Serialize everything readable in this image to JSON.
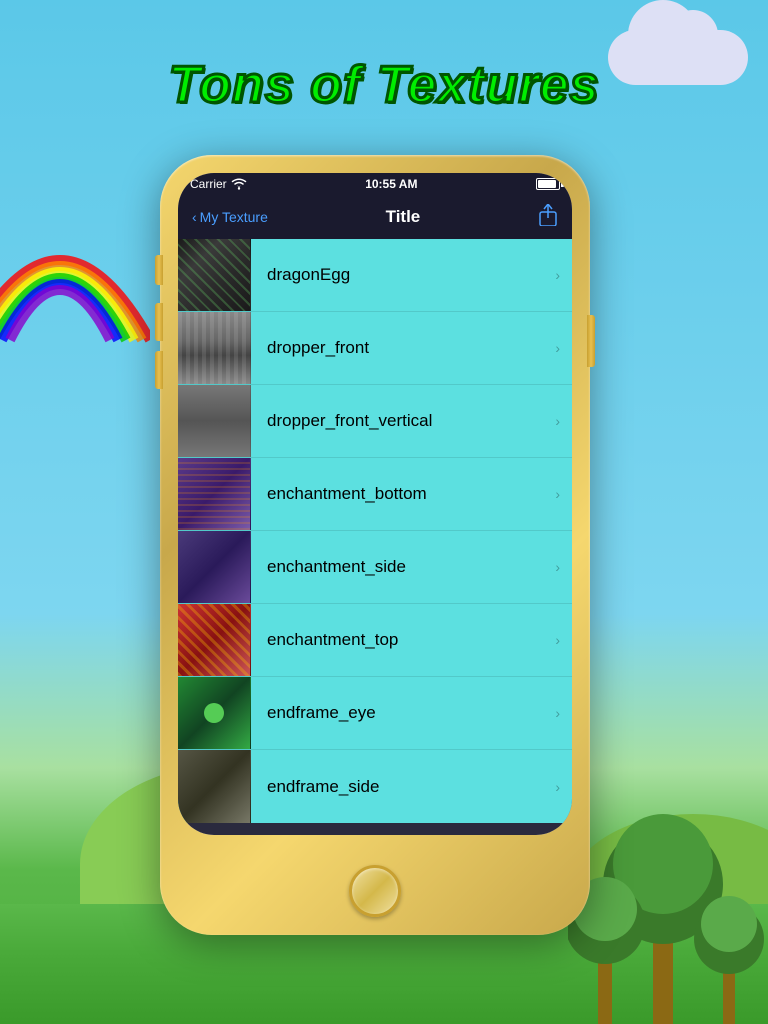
{
  "background": {
    "sky_color_top": "#5bc8e8",
    "sky_color_bottom": "#7dd6f0"
  },
  "page_title": "Tons of Textures",
  "status_bar": {
    "carrier": "Carrier",
    "time": "10:55 AM",
    "battery": "full"
  },
  "nav": {
    "back_label": "My Texture",
    "title": "Title",
    "share_icon": "share-icon"
  },
  "list_items": [
    {
      "id": 1,
      "name": "dragonEgg",
      "thumb_class": "thumb-dragon"
    },
    {
      "id": 2,
      "name": "dropper_front",
      "thumb_class": "thumb-dropper"
    },
    {
      "id": 3,
      "name": "dropper_front_vertical",
      "thumb_class": "thumb-dropper2"
    },
    {
      "id": 4,
      "name": "enchantment_bottom",
      "thumb_class": "thumb-enchant-bottom"
    },
    {
      "id": 5,
      "name": "enchantment_side",
      "thumb_class": "thumb-enchant-side"
    },
    {
      "id": 6,
      "name": "enchantment_top",
      "thumb_class": "thumb-enchant-top"
    },
    {
      "id": 7,
      "name": "endframe_eye",
      "thumb_class": "thumb-endframe-eye"
    },
    {
      "id": 8,
      "name": "endframe_side",
      "thumb_class": "thumb-endframe-side"
    }
  ]
}
